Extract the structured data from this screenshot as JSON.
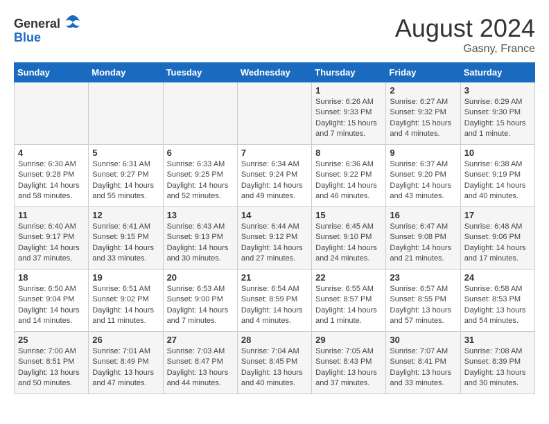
{
  "logo": {
    "general": "General",
    "blue": "Blue"
  },
  "title": "August 2024",
  "location": "Gasny, France",
  "days_of_week": [
    "Sunday",
    "Monday",
    "Tuesday",
    "Wednesday",
    "Thursday",
    "Friday",
    "Saturday"
  ],
  "weeks": [
    [
      {
        "day": "",
        "content": ""
      },
      {
        "day": "",
        "content": ""
      },
      {
        "day": "",
        "content": ""
      },
      {
        "day": "",
        "content": ""
      },
      {
        "day": "1",
        "content": "Sunrise: 6:26 AM\nSunset: 9:33 PM\nDaylight: 15 hours and 7 minutes."
      },
      {
        "day": "2",
        "content": "Sunrise: 6:27 AM\nSunset: 9:32 PM\nDaylight: 15 hours and 4 minutes."
      },
      {
        "day": "3",
        "content": "Sunrise: 6:29 AM\nSunset: 9:30 PM\nDaylight: 15 hours and 1 minute."
      }
    ],
    [
      {
        "day": "4",
        "content": "Sunrise: 6:30 AM\nSunset: 9:28 PM\nDaylight: 14 hours and 58 minutes."
      },
      {
        "day": "5",
        "content": "Sunrise: 6:31 AM\nSunset: 9:27 PM\nDaylight: 14 hours and 55 minutes."
      },
      {
        "day": "6",
        "content": "Sunrise: 6:33 AM\nSunset: 9:25 PM\nDaylight: 14 hours and 52 minutes."
      },
      {
        "day": "7",
        "content": "Sunrise: 6:34 AM\nSunset: 9:24 PM\nDaylight: 14 hours and 49 minutes."
      },
      {
        "day": "8",
        "content": "Sunrise: 6:36 AM\nSunset: 9:22 PM\nDaylight: 14 hours and 46 minutes."
      },
      {
        "day": "9",
        "content": "Sunrise: 6:37 AM\nSunset: 9:20 PM\nDaylight: 14 hours and 43 minutes."
      },
      {
        "day": "10",
        "content": "Sunrise: 6:38 AM\nSunset: 9:19 PM\nDaylight: 14 hours and 40 minutes."
      }
    ],
    [
      {
        "day": "11",
        "content": "Sunrise: 6:40 AM\nSunset: 9:17 PM\nDaylight: 14 hours and 37 minutes."
      },
      {
        "day": "12",
        "content": "Sunrise: 6:41 AM\nSunset: 9:15 PM\nDaylight: 14 hours and 33 minutes."
      },
      {
        "day": "13",
        "content": "Sunrise: 6:43 AM\nSunset: 9:13 PM\nDaylight: 14 hours and 30 minutes."
      },
      {
        "day": "14",
        "content": "Sunrise: 6:44 AM\nSunset: 9:12 PM\nDaylight: 14 hours and 27 minutes."
      },
      {
        "day": "15",
        "content": "Sunrise: 6:45 AM\nSunset: 9:10 PM\nDaylight: 14 hours and 24 minutes."
      },
      {
        "day": "16",
        "content": "Sunrise: 6:47 AM\nSunset: 9:08 PM\nDaylight: 14 hours and 21 minutes."
      },
      {
        "day": "17",
        "content": "Sunrise: 6:48 AM\nSunset: 9:06 PM\nDaylight: 14 hours and 17 minutes."
      }
    ],
    [
      {
        "day": "18",
        "content": "Sunrise: 6:50 AM\nSunset: 9:04 PM\nDaylight: 14 hours and 14 minutes."
      },
      {
        "day": "19",
        "content": "Sunrise: 6:51 AM\nSunset: 9:02 PM\nDaylight: 14 hours and 11 minutes."
      },
      {
        "day": "20",
        "content": "Sunrise: 6:53 AM\nSunset: 9:00 PM\nDaylight: 14 hours and 7 minutes."
      },
      {
        "day": "21",
        "content": "Sunrise: 6:54 AM\nSunset: 8:59 PM\nDaylight: 14 hours and 4 minutes."
      },
      {
        "day": "22",
        "content": "Sunrise: 6:55 AM\nSunset: 8:57 PM\nDaylight: 14 hours and 1 minute."
      },
      {
        "day": "23",
        "content": "Sunrise: 6:57 AM\nSunset: 8:55 PM\nDaylight: 13 hours and 57 minutes."
      },
      {
        "day": "24",
        "content": "Sunrise: 6:58 AM\nSunset: 8:53 PM\nDaylight: 13 hours and 54 minutes."
      }
    ],
    [
      {
        "day": "25",
        "content": "Sunrise: 7:00 AM\nSunset: 8:51 PM\nDaylight: 13 hours and 50 minutes."
      },
      {
        "day": "26",
        "content": "Sunrise: 7:01 AM\nSunset: 8:49 PM\nDaylight: 13 hours and 47 minutes."
      },
      {
        "day": "27",
        "content": "Sunrise: 7:03 AM\nSunset: 8:47 PM\nDaylight: 13 hours and 44 minutes."
      },
      {
        "day": "28",
        "content": "Sunrise: 7:04 AM\nSunset: 8:45 PM\nDaylight: 13 hours and 40 minutes."
      },
      {
        "day": "29",
        "content": "Sunrise: 7:05 AM\nSunset: 8:43 PM\nDaylight: 13 hours and 37 minutes."
      },
      {
        "day": "30",
        "content": "Sunrise: 7:07 AM\nSunset: 8:41 PM\nDaylight: 13 hours and 33 minutes."
      },
      {
        "day": "31",
        "content": "Sunrise: 7:08 AM\nSunset: 8:39 PM\nDaylight: 13 hours and 30 minutes."
      }
    ]
  ]
}
